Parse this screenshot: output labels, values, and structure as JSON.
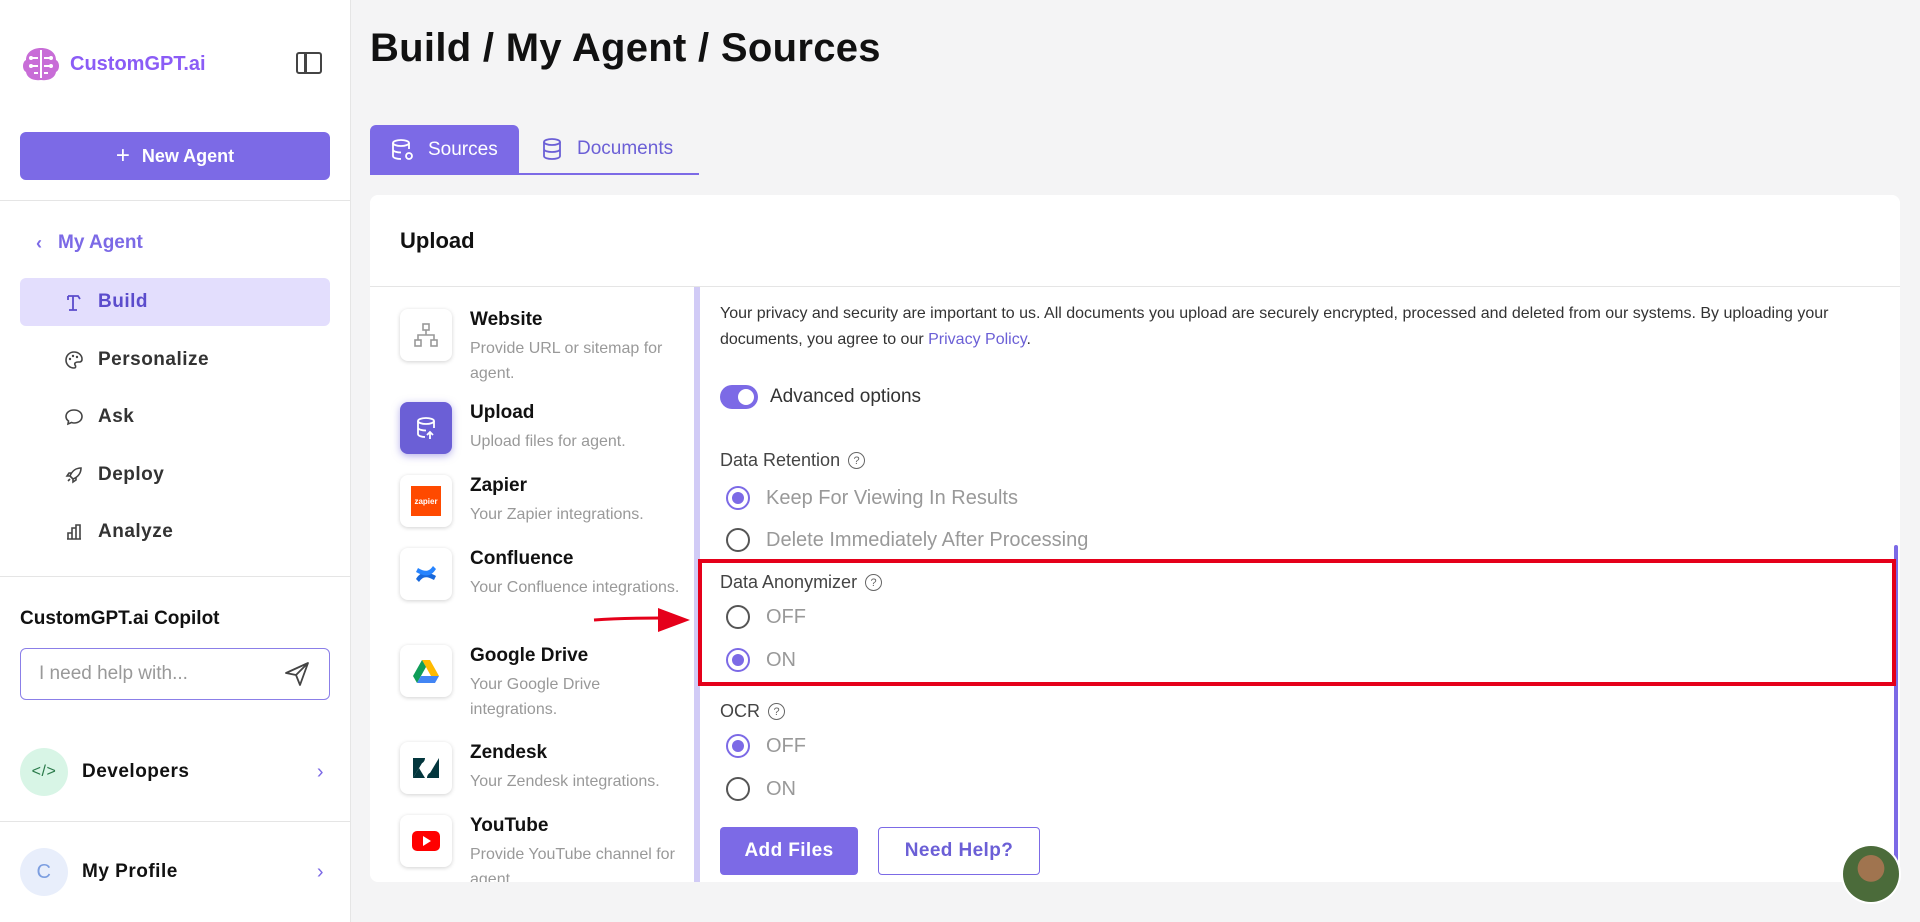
{
  "sidebar": {
    "logo_text": "CustomGPT.ai",
    "new_agent_label": "New Agent",
    "back_label": "My Agent",
    "nav": [
      {
        "label": "Build",
        "icon": "build-icon",
        "active": true
      },
      {
        "label": "Personalize",
        "icon": "palette-icon",
        "active": false
      },
      {
        "label": "Ask",
        "icon": "chat-icon",
        "active": false
      },
      {
        "label": "Deploy",
        "icon": "rocket-icon",
        "active": false
      },
      {
        "label": "Analyze",
        "icon": "bar-chart-icon",
        "active": false
      }
    ],
    "copilot_title": "CustomGPT.ai Copilot",
    "copilot_placeholder": "I need help with...",
    "developers_label": "Developers",
    "developers_icon_text": "</>",
    "profile_label": "My Profile",
    "profile_initial": "C"
  },
  "header": {
    "title": "Build / My Agent / Sources"
  },
  "tabs": [
    {
      "label": "Sources",
      "active": true
    },
    {
      "label": "Documents",
      "active": false
    }
  ],
  "card": {
    "title": "Upload",
    "sources": [
      {
        "name": "Website",
        "desc": "Provide URL or sitemap for agent.",
        "icon": "sitemap-icon"
      },
      {
        "name": "Upload",
        "desc": "Upload files for agent.",
        "icon": "upload-database-icon"
      },
      {
        "name": "Zapier",
        "desc": "Your Zapier integrations.",
        "icon": "zapier-icon",
        "icon_text": "zapier"
      },
      {
        "name": "Confluence",
        "desc": "Your Confluence integrations.",
        "icon": "confluence-icon"
      },
      {
        "name": "Google Drive",
        "desc": "Your Google Drive integrations.",
        "icon": "google-drive-icon"
      },
      {
        "name": "Zendesk",
        "desc": "Your Zendesk integrations.",
        "icon": "zendesk-icon"
      },
      {
        "name": "YouTube",
        "desc": "Provide YouTube channel for agent.",
        "icon": "youtube-icon"
      }
    ],
    "privacy_text": "Your privacy and security are important to us. All documents you upload are securely encrypted, processed and deleted from our systems. By uploading your documents, you agree to our ",
    "privacy_link": "Privacy Policy",
    "privacy_end": ".",
    "advanced_options_label": "Advanced options",
    "advanced_options_on": true,
    "data_retention": {
      "label": "Data Retention",
      "options": [
        {
          "label": "Keep For Viewing In Results",
          "checked": true
        },
        {
          "label": "Delete Immediately After Processing",
          "checked": false
        }
      ]
    },
    "data_anonymizer": {
      "label": "Data Anonymizer",
      "options": [
        {
          "label": "OFF",
          "checked": false
        },
        {
          "label": "ON",
          "checked": true
        }
      ]
    },
    "ocr": {
      "label": "OCR",
      "options": [
        {
          "label": "OFF",
          "checked": true
        },
        {
          "label": "ON",
          "checked": false
        }
      ]
    },
    "add_files_label": "Add Files",
    "need_help_label": "Need Help?"
  },
  "colors": {
    "accent": "#7c6ae6",
    "highlight": "#e5001a"
  }
}
